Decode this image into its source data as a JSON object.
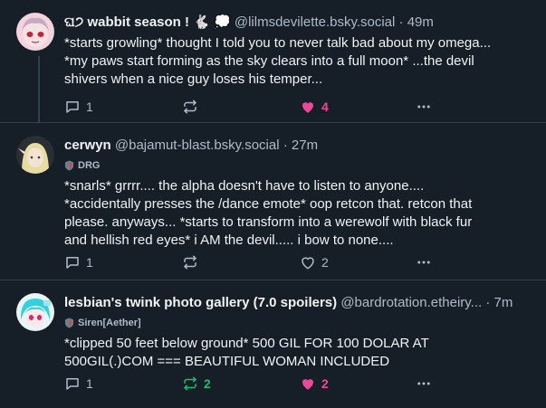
{
  "posts": [
    {
      "display_name": "ଘ੭ wabbit season ! 🐇 💭",
      "handle": "@lilmsdevilette.bsky.social",
      "separator": "·",
      "time": "49m",
      "badge": "",
      "body_lines": [
        "*starts growling* thought I told you to never talk bad about my omega...",
        "*my paws start forming as the sky clears into a full moon* ...the devil",
        "shivers when a nice guy loses his temper..."
      ],
      "reply_count": "1",
      "repost_count": "",
      "like_count": "4",
      "liked": true,
      "reposted": false
    },
    {
      "display_name": "cerwyn",
      "handle": "@bajamut-blast.bsky.social",
      "separator": "·",
      "time": "27m",
      "badge": "DRG",
      "body_lines": [
        "*snarls* grrrr.... the alpha doesn't have to listen to anyone....",
        "*accidentally presses the /dance emote* oop retcon that. retcon that",
        "please. anyways... *starts to transform into a werewolf with black fur",
        "and hellish red eyes* i AM the devil..... i bow to none...."
      ],
      "reply_count": "1",
      "repost_count": "",
      "like_count": "2",
      "liked": false,
      "reposted": false
    },
    {
      "display_name": "lesbian's twink photo gallery (7.0 spoilers)",
      "handle": "@bardrotation.etheiry...",
      "separator": "·",
      "time": "7m",
      "badge": "Siren[Aether]",
      "body_lines": [
        "*clipped 50 feet below ground* 500 GIL FOR 100 DOLAR AT",
        "500GIL(.)COM === BEAUTIFUL WOMAN INCLUDED"
      ],
      "reply_count": "1",
      "repost_count": "2",
      "like_count": "2",
      "liked": true,
      "reposted": true
    }
  ],
  "colors": {
    "background": "#161e27",
    "text": "#f1f3f5",
    "muted": "#aebbc9",
    "like": "#ec4899",
    "repost": "#20bc6c",
    "divider": "#2e4052"
  }
}
